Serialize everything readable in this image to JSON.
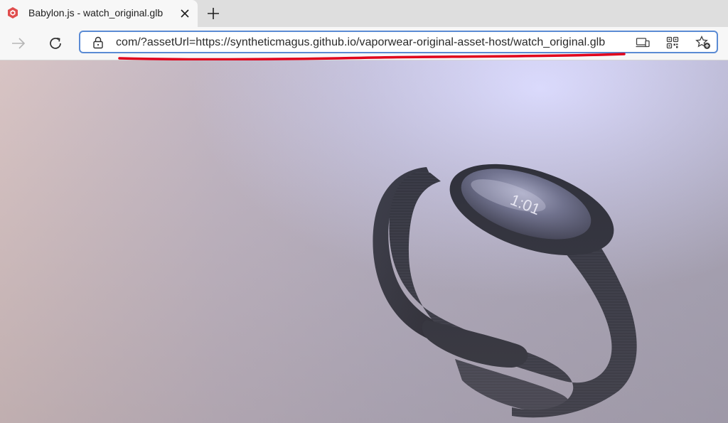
{
  "tab": {
    "title": "Babylon.js - watch_original.glb",
    "favicon": "babylonjs-logo-icon"
  },
  "toolbar": {
    "url": "com/?assetUrl=https://syntheticmagus.github.io/vaporwear-original-asset-host/watch_original.glb"
  },
  "scene": {
    "watch_face_text": "1:01"
  },
  "colors": {
    "accent": "#5b8bd4",
    "annotation": "#e0001b",
    "band": "#2d2f3a",
    "favicon": "#e04e4e"
  }
}
